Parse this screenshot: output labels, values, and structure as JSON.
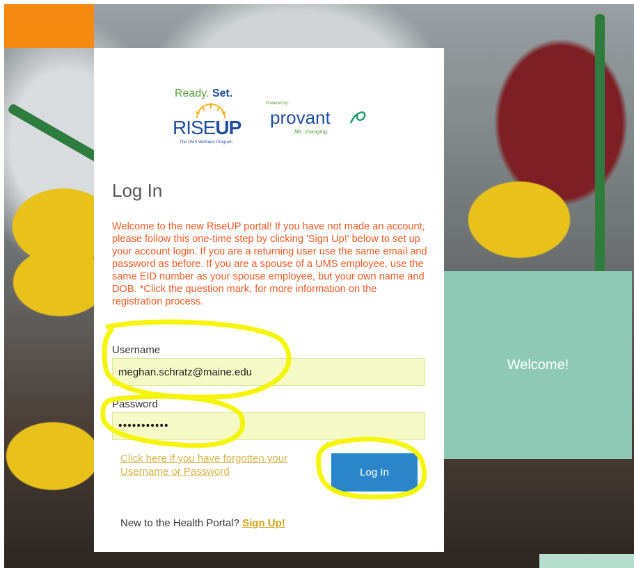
{
  "logo": {
    "ready": "Ready.",
    "set": "Set.",
    "rise": "RISE",
    "up": "UP",
    "tagline": "The UMS Wellness Program",
    "powered_by": "Powered by:",
    "provant": "provant",
    "provant_tagline": "life. changing."
  },
  "login": {
    "title": "Log In",
    "intro": "Welcome to the new RiseUP portal! If you have not made an account, please follow this one-time step by clicking 'Sign Up!' below to set up your account login. If you are a returning user use the same email and password as before. If you are a spouse of a UMS employee, use the same EID number as your spouse employee, but your own name and DOB. *Click the question mark, for more information on the registration process.",
    "username_label": "Username",
    "username_value": "meghan.schratz@maine.edu",
    "password_label": "Password",
    "password_value": "•••••••••••",
    "forgot_link": "Click here if you have forgotten your Username or Password",
    "login_button": "Log In",
    "new_user_text": "New to the Health Portal?",
    "signup_link": "Sign Up!"
  },
  "welcome_panel": {
    "text": "Welcome!"
  },
  "colors": {
    "accent_orange": "#f58a12",
    "intro_text": "#f15a22",
    "button_blue": "#2a86c8",
    "panel_teal": "#8ec9b5",
    "field_bg": "#f5f9c6",
    "highlighter": "#f5f500"
  }
}
